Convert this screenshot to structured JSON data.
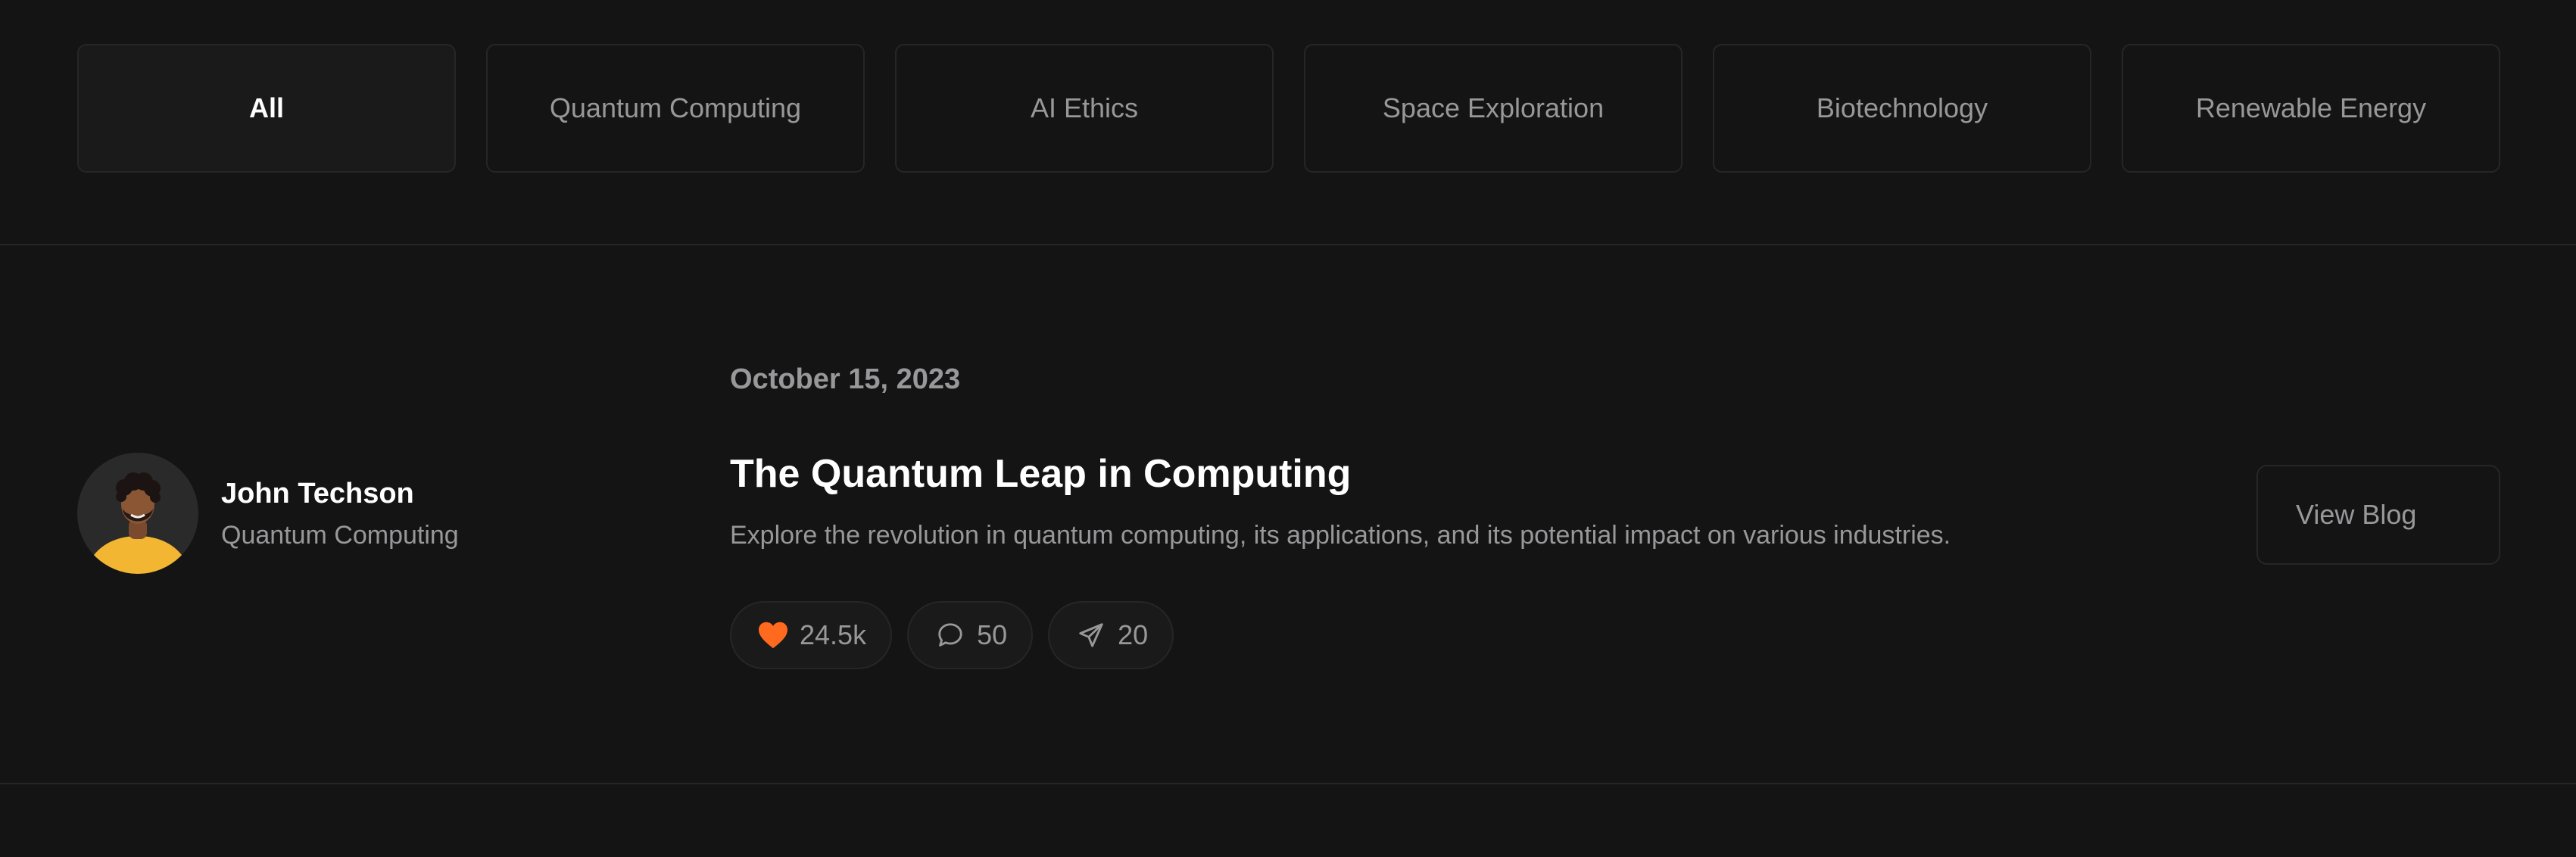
{
  "filters": [
    {
      "label": "All",
      "active": true
    },
    {
      "label": "Quantum Computing",
      "active": false
    },
    {
      "label": "AI Ethics",
      "active": false
    },
    {
      "label": "Space Exploration",
      "active": false
    },
    {
      "label": "Biotechnology",
      "active": false
    },
    {
      "label": "Renewable Energy",
      "active": false
    }
  ],
  "post": {
    "author": {
      "name": "John Techson",
      "category": "Quantum Computing"
    },
    "date": "October 15, 2023",
    "title": "The Quantum Leap in Computing",
    "excerpt": "Explore the revolution in quantum computing, its applications, and its potential impact on various industries.",
    "reactions": {
      "likes": "24.5k",
      "comments": "50",
      "shares": "20"
    },
    "view_label": "View Blog"
  },
  "icons": {
    "like": "heart-icon",
    "comment": "comment-icon",
    "share": "send-icon"
  },
  "colors": {
    "background": "#141414",
    "border": "#262626",
    "muted_text": "#98989a",
    "heart": "#ff6a1f",
    "avatar_shirt": "#f2b632"
  }
}
